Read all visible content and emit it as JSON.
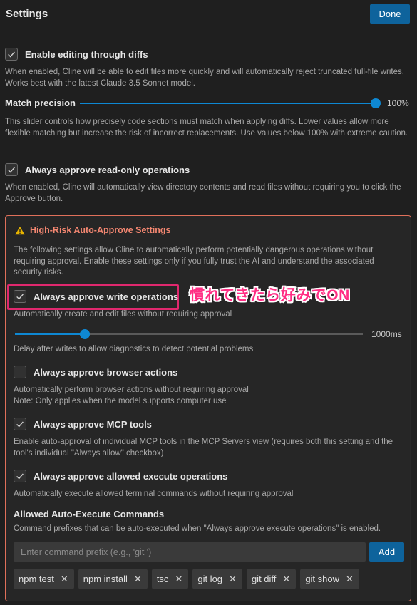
{
  "header": {
    "title": "Settings",
    "done_label": "Done"
  },
  "diffs": {
    "label": "Enable editing through diffs",
    "checked": true,
    "description": "When enabled, Cline will be able to edit files more quickly and will automatically reject truncated full-file writes. Works best with the latest Claude 3.5 Sonnet model."
  },
  "match_precision": {
    "label": "Match precision",
    "value": "100%",
    "level": 1.0,
    "description": "This slider controls how precisely code sections must match when applying diffs. Lower values allow more flexible matching but increase the risk of incorrect replacements. Use values below 100% with extreme caution."
  },
  "read_only": {
    "label": "Always approve read-only operations",
    "checked": true,
    "description": "When enabled, Cline will automatically view directory contents and read files without requiring you to click the Approve button."
  },
  "high_risk": {
    "title": "High-Risk Auto-Approve Settings",
    "description": "The following settings allow Cline to automatically perform potentially dangerous operations without requiring approval. Enable these settings only if you fully trust the AI and understand the associated security risks.",
    "annotation": "慣れてきたら好みでON",
    "write_ops": {
      "label": "Always approve write operations",
      "checked": true,
      "description": "Automatically create and edit files without requiring approval"
    },
    "write_delay": {
      "value": "1000ms",
      "level": 0.2,
      "description": "Delay after writes to allow diagnostics to detect potential problems"
    },
    "browser": {
      "label": "Always approve browser actions",
      "checked": false,
      "description_1": "Automatically perform browser actions without requiring approval",
      "description_2": "Note: Only applies when the model supports computer use"
    },
    "mcp": {
      "label": "Always approve MCP tools",
      "checked": true,
      "description": "Enable auto-approval of individual MCP tools in the MCP Servers view (requires both this setting and the tool's individual \"Always allow\" checkbox)"
    },
    "execute": {
      "label": "Always approve allowed execute operations",
      "checked": true,
      "description": "Automatically execute allowed terminal commands without requiring approval"
    },
    "commands": {
      "heading": "Allowed Auto-Execute Commands",
      "description": "Command prefixes that can be auto-executed when \"Always approve execute operations\" is enabled.",
      "placeholder": "Enter command prefix (e.g., 'git ')",
      "add_label": "Add",
      "tags": [
        "npm test",
        "npm install",
        "tsc",
        "git log",
        "git diff",
        "git show"
      ],
      "remove_glyph": "✕"
    }
  }
}
